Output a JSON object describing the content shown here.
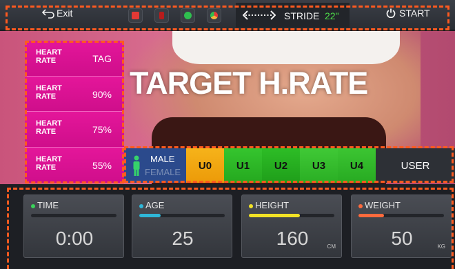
{
  "topbar": {
    "exit_label": "Exit",
    "apps": [
      {
        "name": "youtube-icon",
        "color": "#e53935"
      },
      {
        "name": "netflix-icon",
        "color": "#c62828"
      },
      {
        "name": "spotify-icon",
        "color": "#2fbf4f"
      },
      {
        "name": "chrome-icon",
        "color": "#f2b33d"
      }
    ],
    "stride_label": "STRIDE",
    "stride_value": "22\"",
    "start_label": "START"
  },
  "hero": {
    "title": "TARGET H.RATE"
  },
  "heart_rate": {
    "items": [
      {
        "label": "HEART RATE",
        "value": "TAG"
      },
      {
        "label": "HEART RATE",
        "value": "90%"
      },
      {
        "label": "HEART RATE",
        "value": "75%"
      },
      {
        "label": "HEART RATE",
        "value": "55%"
      }
    ]
  },
  "gender": {
    "male": "MALE",
    "female": "FEMALE"
  },
  "users": [
    {
      "label": "U0",
      "color": "#f2a40f"
    },
    {
      "label": "U1",
      "color": "#2fbf28"
    },
    {
      "label": "U2",
      "color": "#26b31f"
    },
    {
      "label": "U3",
      "color": "#39c42f"
    },
    {
      "label": "U4",
      "color": "#34c02a"
    }
  ],
  "user_button": "USER",
  "panels": [
    {
      "label": "TIME",
      "value": "0:00",
      "unit": "",
      "dot": "#3ad35a",
      "fill": "#3ad35a",
      "level": 0.0
    },
    {
      "label": "AGE",
      "value": "25",
      "unit": "",
      "dot": "#2fb7d8",
      "fill": "#2fb7d8",
      "level": 0.25
    },
    {
      "label": "HEIGHT",
      "value": "160",
      "unit": "CM",
      "dot": "#f2e226",
      "fill": "#f2e226",
      "level": 0.6
    },
    {
      "label": "WEIGHT",
      "value": "50",
      "unit": "KG",
      "dot": "#ff6a3d",
      "fill": "#ff6a3d",
      "level": 0.3
    }
  ]
}
